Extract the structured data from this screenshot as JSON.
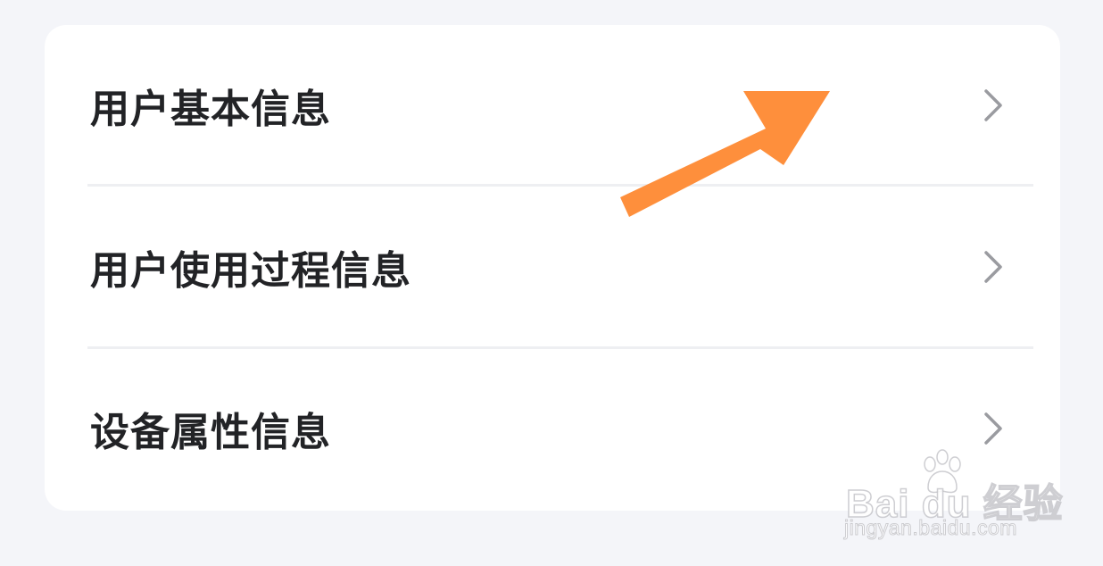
{
  "list": {
    "items": [
      {
        "label": "用户基本信息",
        "icon": "chevron-right-icon"
      },
      {
        "label": "用户使用过程信息",
        "icon": "chevron-right-icon"
      },
      {
        "label": "设备属性信息",
        "icon": "chevron-right-icon"
      }
    ]
  },
  "annotation": {
    "icon": "arrow-annotation-icon",
    "color": "#fe8f3c"
  },
  "watermark": {
    "brand": "Bai du 经验",
    "url": "jingyan.baidu.com",
    "icon": "paw-icon"
  },
  "colors": {
    "background": "#f4f5f9",
    "card": "#ffffff",
    "text": "#222326",
    "chevron": "#9a9ba0",
    "divider": "#eeeff2"
  }
}
